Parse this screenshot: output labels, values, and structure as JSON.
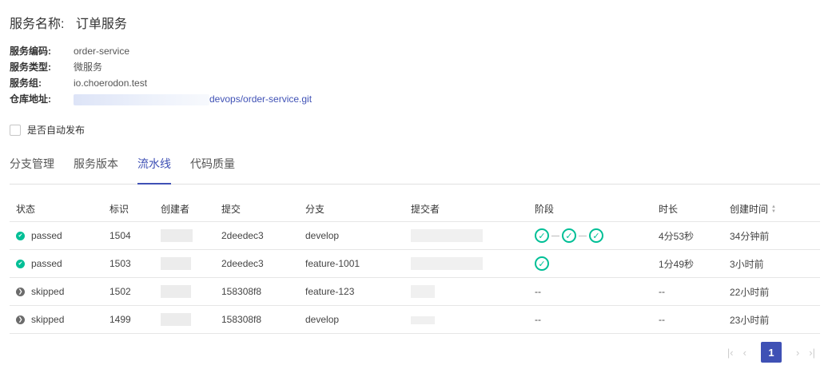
{
  "service": {
    "name_label": "服务名称:",
    "name_value": "订单服务",
    "code_label": "服务编码:",
    "code_value": "order-service",
    "type_label": "服务类型:",
    "type_value": "微服务",
    "group_label": "服务组:",
    "group_value": "io.choerodon.test",
    "repo_label": "仓库地址:",
    "repo_value": "devops/order-service.git"
  },
  "auto_release_label": "是否自动发布",
  "tabs": [
    {
      "label": "分支管理"
    },
    {
      "label": "服务版本"
    },
    {
      "label": "流水线"
    },
    {
      "label": "代码质量"
    }
  ],
  "columns": [
    "状态",
    "标识",
    "创建者",
    "提交",
    "分支",
    "提交者",
    "阶段",
    "时长",
    "创建时间"
  ],
  "rows": [
    {
      "status": "passed",
      "id": "1504",
      "commit": "2deedec3",
      "branch": "develop",
      "duration": "4分53秒",
      "created": "34分钟前"
    },
    {
      "status": "passed",
      "id": "1503",
      "commit": "2deedec3",
      "branch": "feature-1001",
      "duration": "1分49秒",
      "created": "3小时前"
    },
    {
      "status": "skipped",
      "id": "1502",
      "commit": "158308f8",
      "branch": "feature-123",
      "stage": "--",
      "duration": "--",
      "created": "22小时前"
    },
    {
      "status": "skipped",
      "id": "1499",
      "commit": "158308f8",
      "branch": "develop",
      "stage": "--",
      "duration": "--",
      "created": "23小时前"
    }
  ],
  "pagination": {
    "current": "1"
  },
  "colors": {
    "accent": "#3f51b5",
    "success": "#00bf96",
    "skipped": "#6b6b6b"
  }
}
